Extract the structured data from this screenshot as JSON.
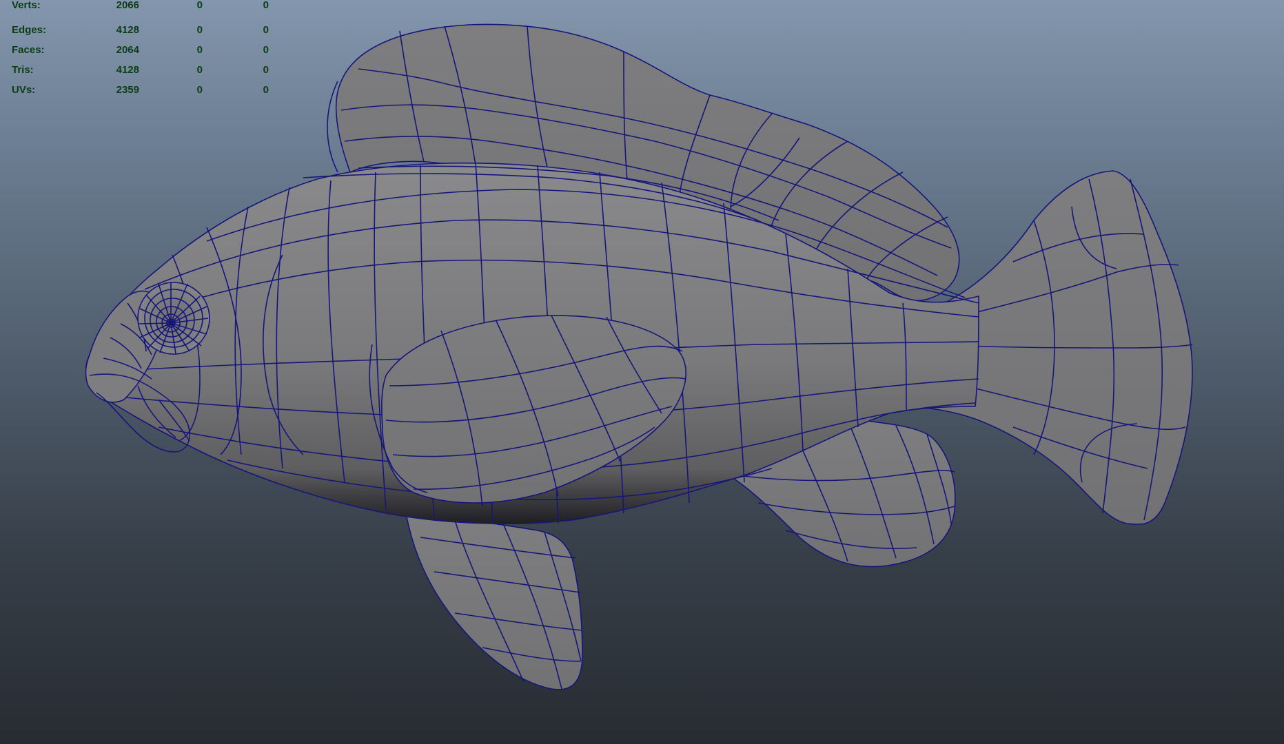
{
  "heads_up_display": {
    "rows": [
      {
        "label": "Verts:",
        "total": "2066",
        "selected": "0",
        "uv": "0"
      },
      {
        "label": "Edges:",
        "total": "4128",
        "selected": "0",
        "uv": "0"
      },
      {
        "label": "Faces:",
        "total": "2064",
        "selected": "0",
        "uv": "0"
      },
      {
        "label": "Tris:",
        "total": "4128",
        "selected": "0",
        "uv": "0"
      },
      {
        "label": "UVs:",
        "total": "2359",
        "selected": "0",
        "uv": "0"
      }
    ]
  },
  "colors": {
    "hud_text": "#0b3d14",
    "mesh_surface": "#7a7a7c",
    "wireframe": "#16167a",
    "background_top": "#8396ad",
    "background_bottom": "#272c32"
  },
  "model": {
    "icon": "fish-mesh-icon"
  }
}
